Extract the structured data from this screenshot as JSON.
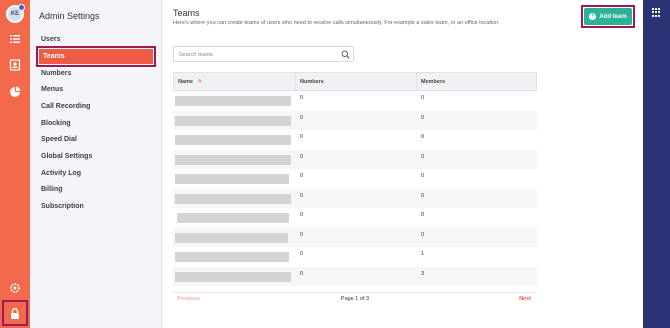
{
  "rail": {
    "avatar_initials": "KE",
    "accent": "#f26a4b",
    "highlight": "#9b1a58",
    "icons": [
      "list-icon",
      "contacts-icon",
      "chart-icon",
      "settings-icon",
      "lock-icon"
    ]
  },
  "sidebar": {
    "title": "Admin Settings",
    "items": [
      {
        "label": "Users"
      },
      {
        "label": "Teams",
        "active": true
      },
      {
        "label": "Numbers"
      },
      {
        "label": "Menus"
      },
      {
        "label": "Call Recording"
      },
      {
        "label": "Blocking"
      },
      {
        "label": "Speed Dial"
      },
      {
        "label": "Global Settings"
      },
      {
        "label": "Activity Log"
      },
      {
        "label": "Billing"
      },
      {
        "label": "Subscription"
      }
    ]
  },
  "main": {
    "title": "Teams",
    "description": "Here's where you can create teams of users who need to receive calls simultaneously. For example a sales team, or an office location.",
    "add_team_label": "Add team",
    "add_team_color": "#2bb39a",
    "search_placeholder": "Search teams",
    "table": {
      "columns": [
        "Name",
        "Numbers",
        "Members"
      ],
      "rows": [
        {
          "numbers": "0",
          "members": "0"
        },
        {
          "numbers": "0",
          "members": "0"
        },
        {
          "numbers": "0",
          "members": "0"
        },
        {
          "numbers": "0",
          "members": "0"
        },
        {
          "numbers": "0",
          "members": "0"
        },
        {
          "numbers": "0",
          "members": "0"
        },
        {
          "numbers": "0",
          "members": "0"
        },
        {
          "numbers": "0",
          "members": "0"
        },
        {
          "numbers": "0",
          "members": "1"
        },
        {
          "numbers": "0",
          "members": "3"
        }
      ]
    },
    "pager": {
      "previous": "Previous",
      "info": "Page 1 of 3",
      "next": "Next"
    }
  }
}
